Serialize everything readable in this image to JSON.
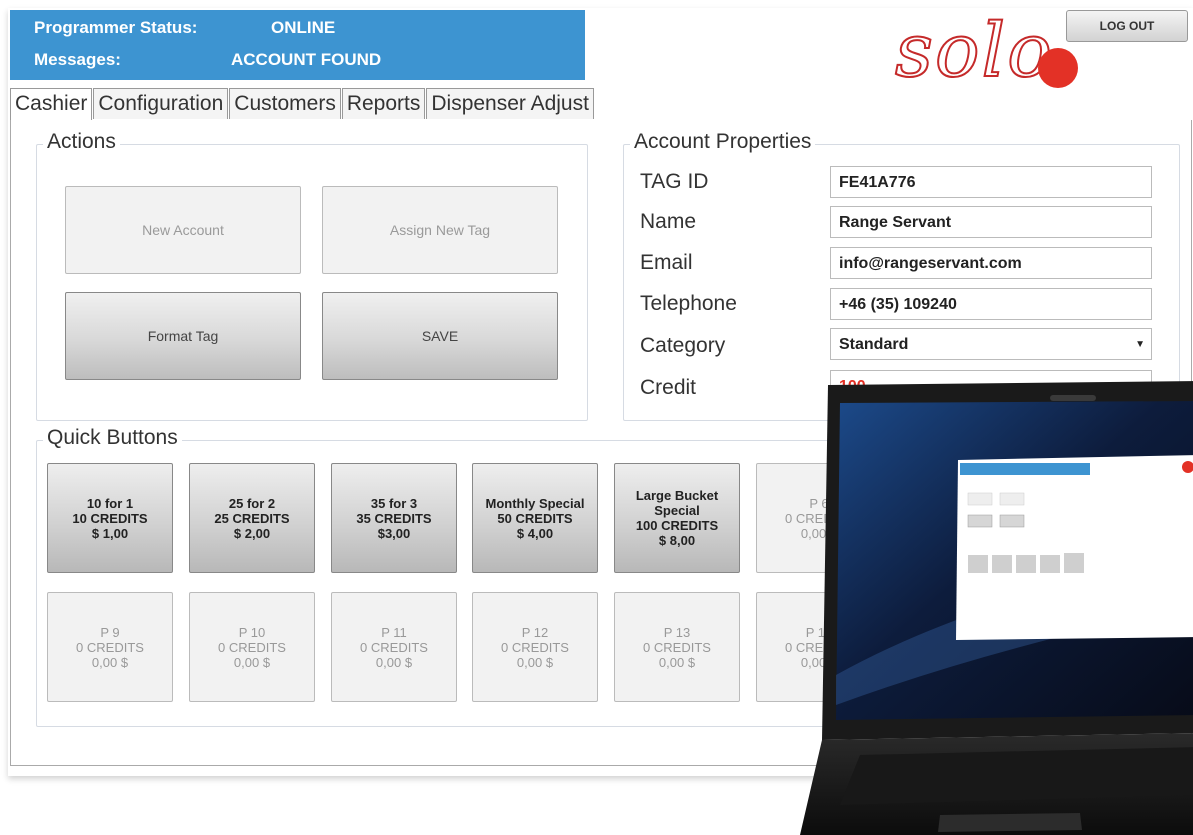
{
  "status": {
    "programmer_label": "Programmer Status:",
    "programmer_value": "ONLINE",
    "messages_label": "Messages:",
    "messages_value": "ACCOUNT FOUND"
  },
  "logo_text": "solo",
  "logout_label": "LOG OUT",
  "tabs": [
    "Cashier",
    "Configuration",
    "Customers",
    "Reports",
    "Dispenser Adjust"
  ],
  "actions": {
    "title": "Actions",
    "buttons": [
      "New Account",
      "Assign New Tag",
      "Format Tag",
      "SAVE"
    ]
  },
  "account_properties": {
    "title": "Account Properties",
    "fields": [
      {
        "label": "TAG ID",
        "value": "FE41A776"
      },
      {
        "label": "Name",
        "value": "Range Servant"
      },
      {
        "label": "Email",
        "value": "info@rangeservant.com"
      },
      {
        "label": "Telephone",
        "value": "+46 (35) 109240"
      },
      {
        "label": "Category",
        "value": "Standard"
      },
      {
        "label": "Credit",
        "value": "100"
      }
    ]
  },
  "quick_buttons": {
    "title": "Quick Buttons",
    "row1": [
      {
        "line1": "10 for 1",
        "line2": "10 CREDITS",
        "line3": "$ 1,00"
      },
      {
        "line1": "25 for 2",
        "line2": "25 CREDITS",
        "line3": "$ 2,00"
      },
      {
        "line1": "35 for 3",
        "line2": "35 CREDITS",
        "line3": "$3,00"
      },
      {
        "line1": "Monthly Special",
        "line2": "50 CREDITS",
        "line3": "$ 4,00"
      },
      {
        "line1": "Large Bucket Special",
        "line2": "100 CREDITS",
        "line3": "$ 8,00"
      },
      {
        "line1": "P 6",
        "line2": "0 CREDITS",
        "line3": "0,00 $"
      }
    ],
    "row2": [
      {
        "line1": "P 9",
        "line2": "0 CREDITS",
        "line3": "0,00 $"
      },
      {
        "line1": "P 10",
        "line2": "0 CREDITS",
        "line3": "0,00 $"
      },
      {
        "line1": "P 11",
        "line2": "0 CREDITS",
        "line3": "0,00 $"
      },
      {
        "line1": "P 12",
        "line2": "0 CREDITS",
        "line3": "0,00 $"
      },
      {
        "line1": "P 13",
        "line2": "0 CREDITS",
        "line3": "0,00 $"
      },
      {
        "line1": "P 14",
        "line2": "0 CREDITS",
        "line3": "0,00 $"
      }
    ]
  },
  "colors": {
    "status_bg": "#3d94d1",
    "logo_red": "#e33126",
    "credit_red": "#e33126"
  }
}
